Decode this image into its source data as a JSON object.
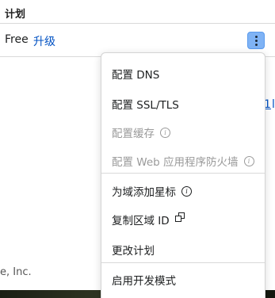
{
  "table": {
    "column_header": "计划",
    "plan_name": "Free",
    "upgrade_label": "升级",
    "peek_link": "1",
    "peek_link2": "l"
  },
  "footer": {
    "text": "e, Inc."
  },
  "menu": {
    "items": [
      {
        "label": "配置 DNS",
        "disabled": false
      },
      {
        "label": "配置 SSL/TLS",
        "disabled": false
      },
      {
        "label": "配置缓存",
        "disabled": true
      },
      {
        "label": "配置 Web 应用程序防火墙",
        "disabled": true
      },
      {
        "label": "为域添加星标",
        "disabled": false
      },
      {
        "label": "复制区域 ID",
        "disabled": false
      },
      {
        "label": "更改计划",
        "disabled": false
      },
      {
        "label": "启用开发模式",
        "disabled": false
      }
    ]
  },
  "colors": {
    "link": "#0051c3",
    "kebab_bg": "#7fb3f5"
  }
}
